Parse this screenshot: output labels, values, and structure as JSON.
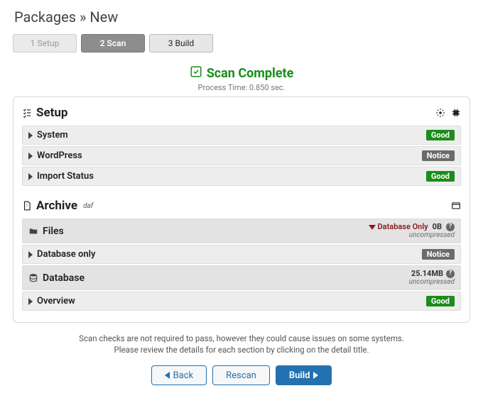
{
  "page_title": "Packages » New",
  "steps": {
    "s1": "1 Setup",
    "s2": "2 Scan",
    "s3": "3 Build"
  },
  "scan": {
    "complete_label": "Scan Complete",
    "process_time": "Process Time: 0.850 sec."
  },
  "setup": {
    "title": "Setup",
    "items": [
      {
        "label": "System",
        "status": "Good",
        "status_class": "good"
      },
      {
        "label": "WordPress",
        "status": "Notice",
        "status_class": "notice"
      },
      {
        "label": "Import Status",
        "status": "Good",
        "status_class": "good"
      }
    ]
  },
  "archive": {
    "title": "Archive",
    "sup": "daf",
    "files": {
      "header": "Files",
      "db_only_flag": "Database Only",
      "size": "0B",
      "uncompressed": "uncompressed",
      "rows": [
        {
          "label": "Database only",
          "status": "Notice",
          "status_class": "notice"
        }
      ]
    },
    "database": {
      "header": "Database",
      "size": "25.14MB",
      "uncompressed": "uncompressed",
      "rows": [
        {
          "label": "Overview",
          "status": "Good",
          "status_class": "good"
        }
      ]
    }
  },
  "footer": {
    "note_line1": "Scan checks are not required to pass, however they could cause issues on some systems.",
    "note_line2": "Please review the details for each section by clicking on the detail title.",
    "back": "Back",
    "rescan": "Rescan",
    "build": "Build"
  }
}
